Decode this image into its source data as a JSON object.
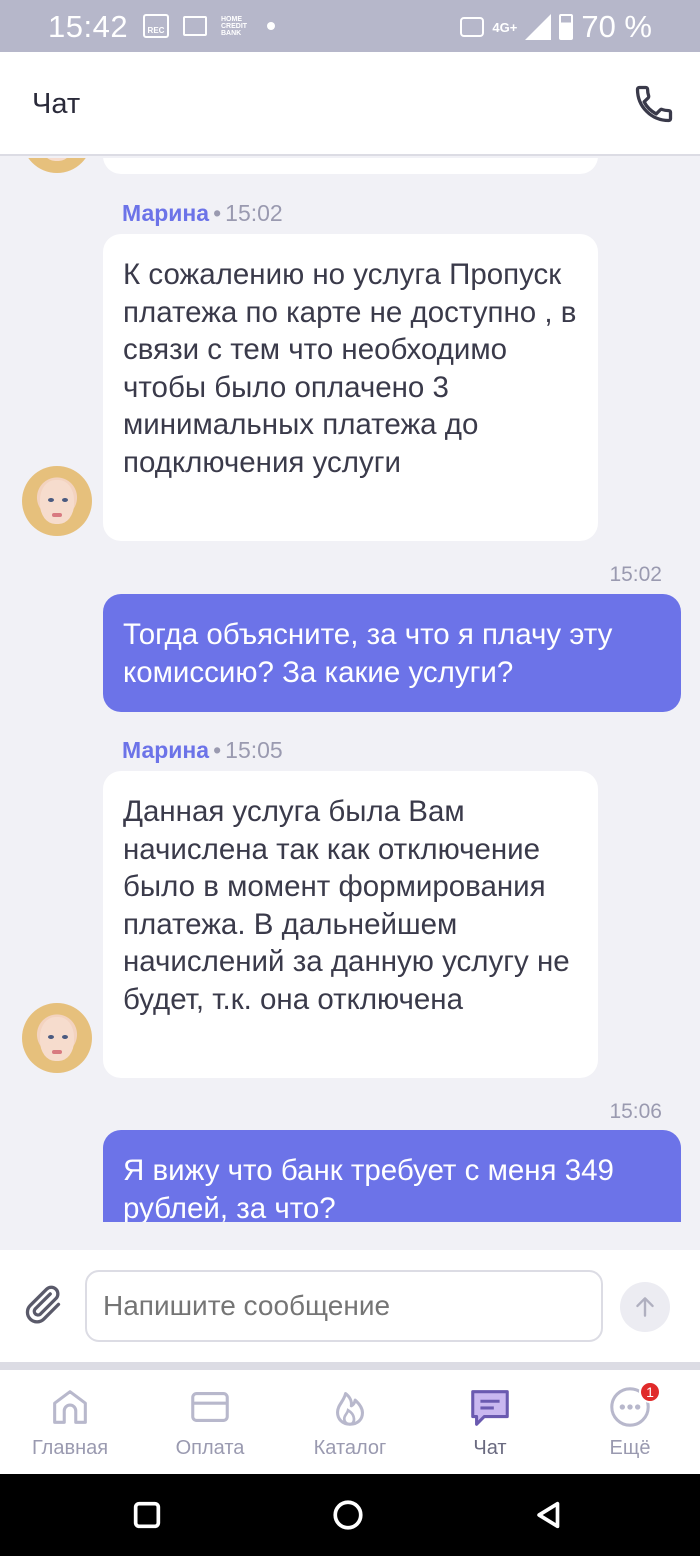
{
  "status_bar": {
    "time": "15:42",
    "rec_label": "REC",
    "bank_label": "HOME CREDIT BANK",
    "network": "4G+",
    "battery": "70 %",
    "battery_level": 0.7
  },
  "header": {
    "title": "Чат",
    "call_icon": "phone-icon"
  },
  "messages": [
    {
      "type": "in",
      "sender": "Марина",
      "time": "15:02",
      "text": "К сожалению но услуга Пропуск платежа по карте не доступно ,  в связи с тем что необходимо чтобы было оплачено 3 минимальных платежа до подключения услуги"
    },
    {
      "type": "out",
      "time": "15:02",
      "text": "Тогда объясните, за что я плачу эту комиссию? За какие услуги?"
    },
    {
      "type": "in",
      "sender": "Марина",
      "time": "15:05",
      "text": "Данная услуга была Вам начислена так как отключение было в момент формирования платежа. В дальнейшем начислений за данную услугу не будет, т.к. она отключена"
    },
    {
      "type": "out",
      "time": "15:06",
      "text": "Я вижу что банк требует с меня 349 рублей, за что?"
    }
  ],
  "input": {
    "placeholder": "Напишите сообщение"
  },
  "nav": {
    "items": [
      {
        "label": "Главная",
        "icon": "home-icon"
      },
      {
        "label": "Оплата",
        "icon": "card-icon"
      },
      {
        "label": "Каталог",
        "icon": "flame-icon"
      },
      {
        "label": "Чат",
        "icon": "chat-icon",
        "active": true
      },
      {
        "label": "Ещё",
        "icon": "more-icon",
        "badge": "1"
      }
    ]
  },
  "colors": {
    "accent": "#6c73e8",
    "background": "#f1f1f6",
    "badge": "#e02a2a"
  }
}
